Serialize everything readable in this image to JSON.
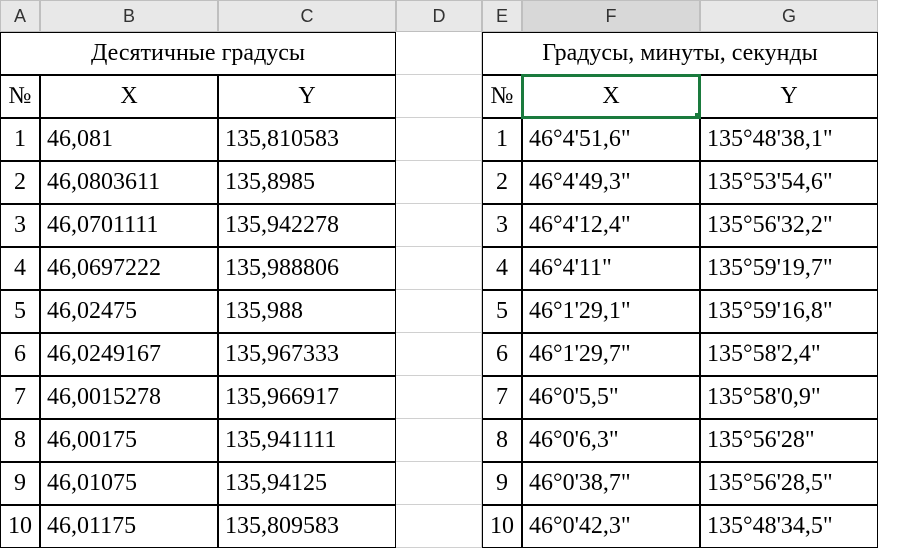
{
  "columns": [
    "A",
    "B",
    "C",
    "D",
    "E",
    "F",
    "G"
  ],
  "selected_column": "F",
  "left": {
    "title": "Десятичные градусы",
    "headers": {
      "num": "№",
      "x": "X",
      "y": "Y"
    },
    "rows": [
      {
        "n": "1",
        "x": "46,081",
        "y": "135,810583"
      },
      {
        "n": "2",
        "x": "46,0803611",
        "y": "135,8985"
      },
      {
        "n": "3",
        "x": "46,0701111",
        "y": "135,942278"
      },
      {
        "n": "4",
        "x": "46,0697222",
        "y": "135,988806"
      },
      {
        "n": "5",
        "x": "46,02475",
        "y": "135,988"
      },
      {
        "n": "6",
        "x": "46,0249167",
        "y": "135,967333"
      },
      {
        "n": "7",
        "x": "46,0015278",
        "y": "135,966917"
      },
      {
        "n": "8",
        "x": "46,00175",
        "y": "135,941111"
      },
      {
        "n": "9",
        "x": "46,01075",
        "y": "135,94125"
      },
      {
        "n": "10",
        "x": "46,01175",
        "y": "135,809583"
      }
    ]
  },
  "right": {
    "title": "Градусы, минуты, секунды",
    "headers": {
      "num": "№",
      "x": "X",
      "y": "Y"
    },
    "rows": [
      {
        "n": "1",
        "x": "46°4'51,6\"",
        "y": "135°48'38,1\""
      },
      {
        "n": "2",
        "x": "46°4'49,3\"",
        "y": "135°53'54,6\""
      },
      {
        "n": "3",
        "x": "46°4'12,4\"",
        "y": "135°56'32,2\""
      },
      {
        "n": "4",
        "x": "46°4'11\"",
        "y": "135°59'19,7\""
      },
      {
        "n": "5",
        "x": "46°1'29,1\"",
        "y": "135°59'16,8\""
      },
      {
        "n": "6",
        "x": "46°1'29,7\"",
        "y": "135°58'2,4\""
      },
      {
        "n": "7",
        "x": "46°0'5,5\"",
        "y": "135°58'0,9\""
      },
      {
        "n": "8",
        "x": "46°0'6,3\"",
        "y": "135°56'28\""
      },
      {
        "n": "9",
        "x": "46°0'38,7\"",
        "y": "135°56'28,5\""
      },
      {
        "n": "10",
        "x": "46°0'42,3\"",
        "y": "135°48'34,5\""
      }
    ]
  },
  "chart_data": {
    "type": "table",
    "sheets": [
      {
        "title": "Десятичные градусы",
        "columns": [
          "№",
          "X",
          "Y"
        ],
        "rows": [
          [
            1,
            46.081,
            135.810583
          ],
          [
            2,
            46.0803611,
            135.8985
          ],
          [
            3,
            46.0701111,
            135.942278
          ],
          [
            4,
            46.0697222,
            135.988806
          ],
          [
            5,
            46.02475,
            135.988
          ],
          [
            6,
            46.0249167,
            135.967333
          ],
          [
            7,
            46.0015278,
            135.966917
          ],
          [
            8,
            46.00175,
            135.941111
          ],
          [
            9,
            46.01075,
            135.94125
          ],
          [
            10,
            46.01175,
            135.809583
          ]
        ]
      },
      {
        "title": "Градусы, минуты, секунды",
        "columns": [
          "№",
          "X",
          "Y"
        ],
        "rows": [
          [
            1,
            "46°4'51,6\"",
            "135°48'38,1\""
          ],
          [
            2,
            "46°4'49,3\"",
            "135°53'54,6\""
          ],
          [
            3,
            "46°4'12,4\"",
            "135°56'32,2\""
          ],
          [
            4,
            "46°4'11\"",
            "135°59'19,7\""
          ],
          [
            5,
            "46°1'29,1\"",
            "135°59'16,8\""
          ],
          [
            6,
            "46°1'29,7\"",
            "135°58'2,4\""
          ],
          [
            7,
            "46°0'5,5\"",
            "135°58'0,9\""
          ],
          [
            8,
            "46°0'6,3\"",
            "135°56'28\""
          ],
          [
            9,
            "46°0'38,7\"",
            "135°56'28,5\""
          ],
          [
            10,
            "46°0'42,3\"",
            "135°48'34,5\""
          ]
        ]
      }
    ]
  }
}
